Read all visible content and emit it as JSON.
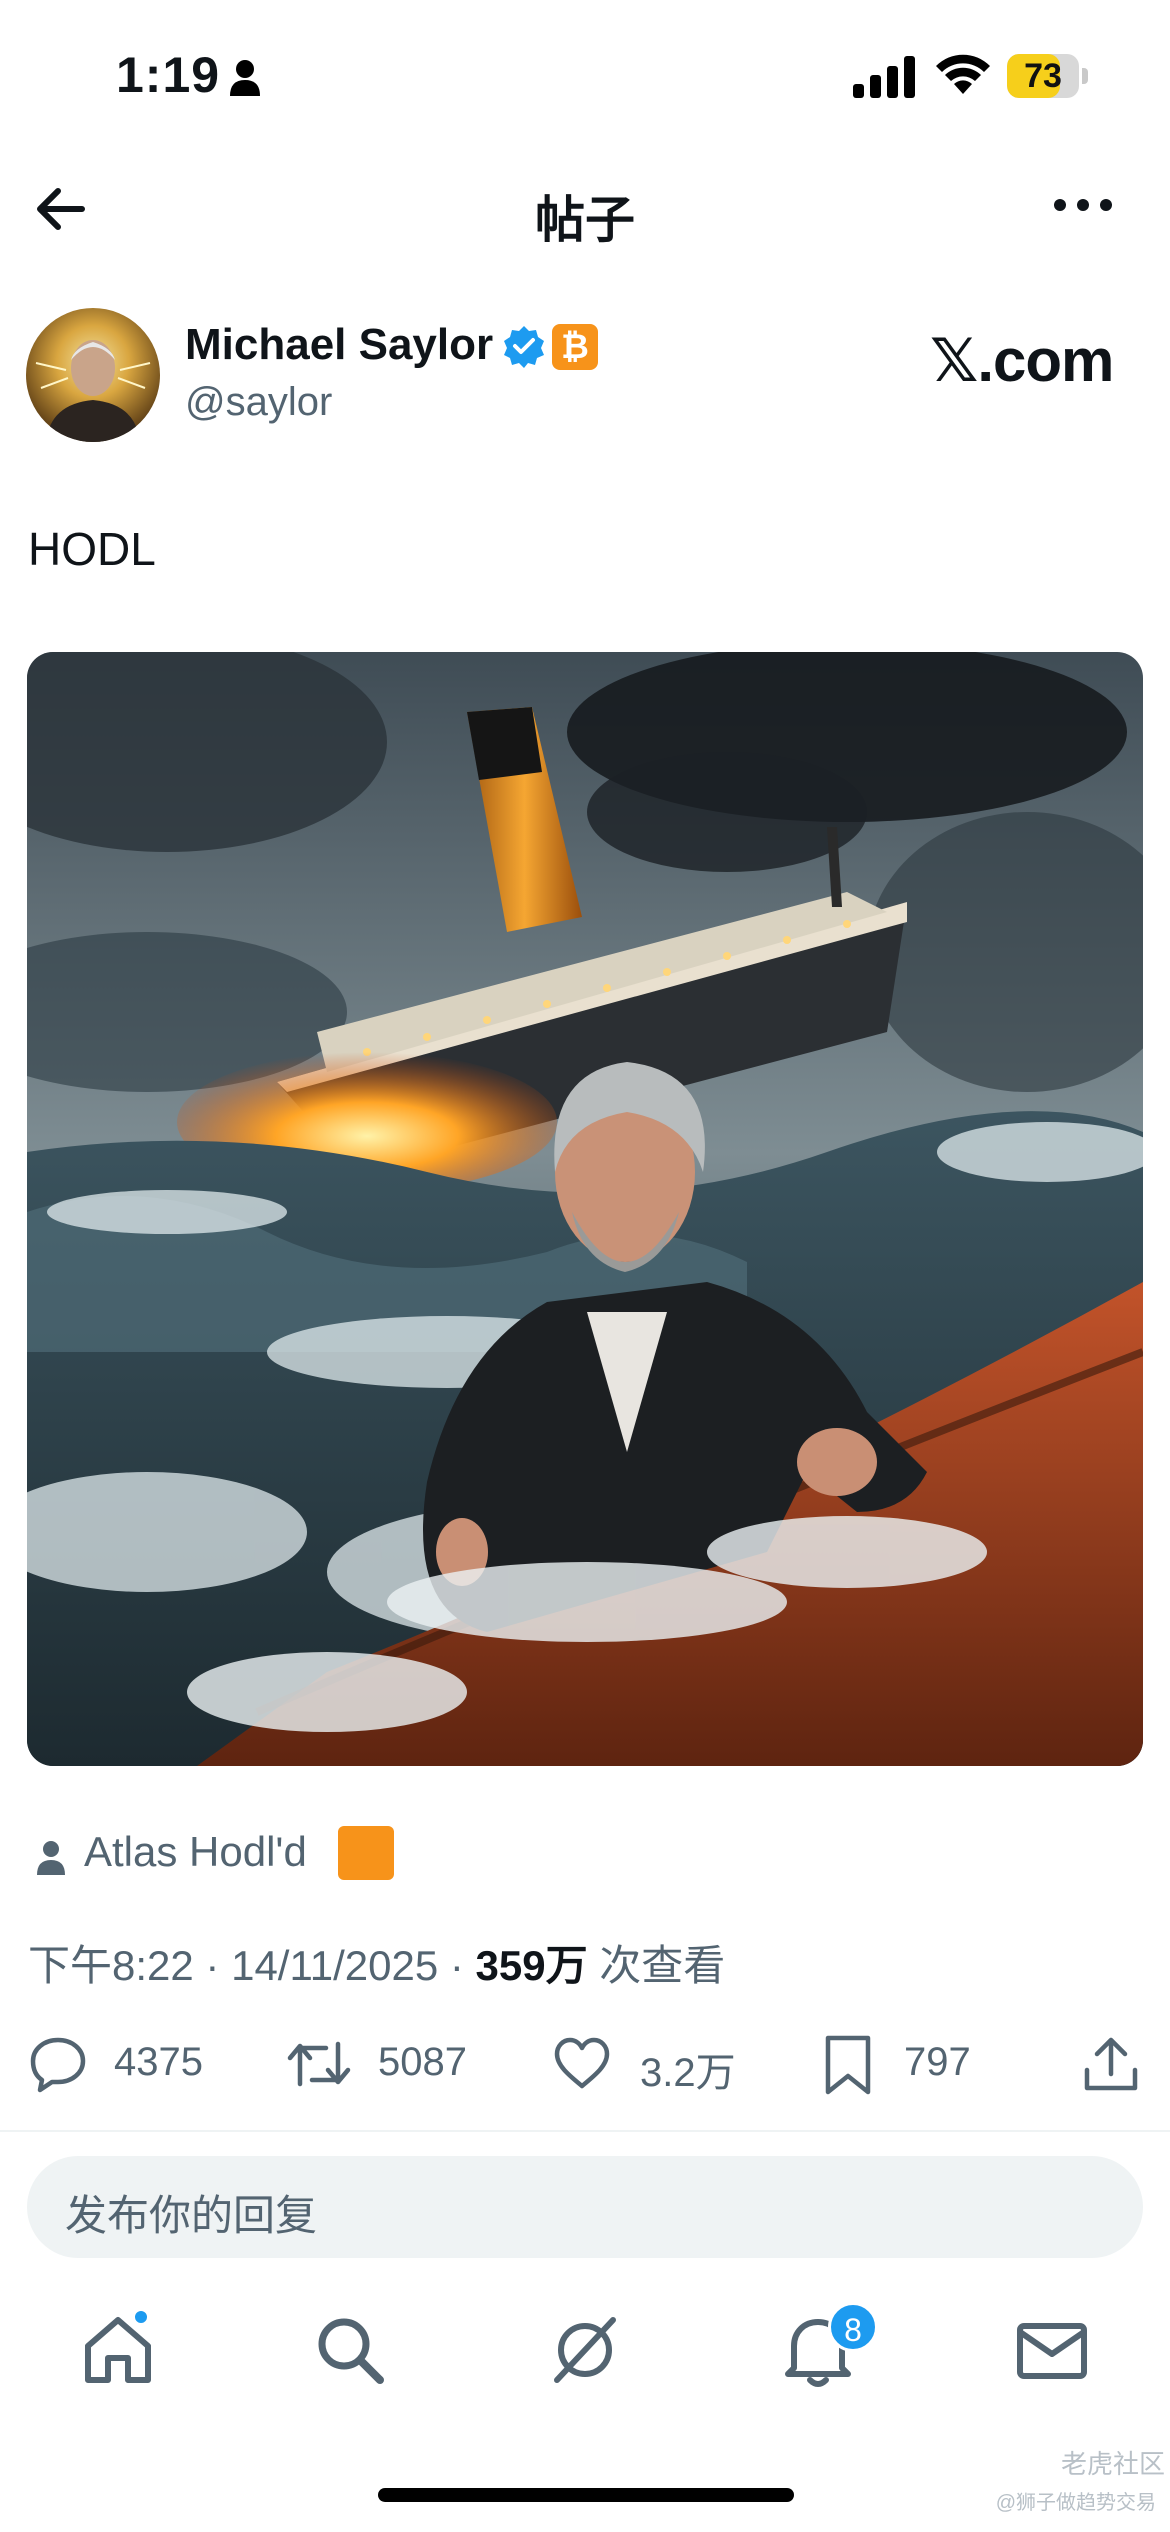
{
  "status_bar": {
    "time": "1:19",
    "battery": "73",
    "battery_level": 0.73
  },
  "header": {
    "title": "帖子"
  },
  "author": {
    "name": "Michael Saylor",
    "handle": "@saylor",
    "badge": "₿",
    "source": "𝕏.com"
  },
  "post": {
    "text": "HODL"
  },
  "community": {
    "name": "Atlas Hodl'd"
  },
  "meta": {
    "time": "下午8:22",
    "sep1": "·",
    "date": "14/11/2025",
    "sep2": "·",
    "views": "359万",
    "views_label": "次查看"
  },
  "actions": {
    "replies": "4375",
    "reposts": "5087",
    "likes": "3.2万",
    "bookmarks": "797"
  },
  "reply": {
    "placeholder": "发布你的回复"
  },
  "tabbar": {
    "notifications_badge": "8"
  },
  "watermark": {
    "main": "老虎社区",
    "sub": "@狮子做趋势交易"
  },
  "colors": {
    "accent": "#1d9bf0",
    "secondary_text": "#536471",
    "bitcoin": "#f7931a",
    "battery": "#f6cf1b"
  }
}
